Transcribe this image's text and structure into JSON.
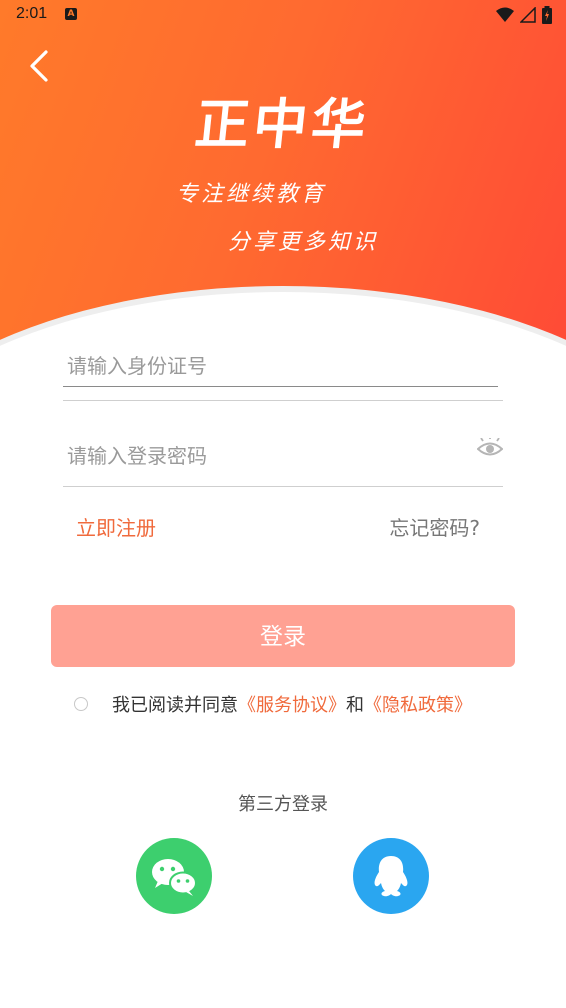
{
  "status_bar": {
    "time": "2:01",
    "a_badge": "A"
  },
  "header": {
    "app_title": "正中华",
    "slogan_line1": "专注继续教育",
    "slogan_line2": "分享更多知识",
    "gradient_start": "#ff7a2a",
    "gradient_end": "#ff4a36"
  },
  "form": {
    "id_placeholder": "请输入身份证号",
    "id_value": "",
    "password_placeholder": "请输入登录密码",
    "password_value": "",
    "register_label": "立即注册",
    "forgot_label": "忘记密码?",
    "login_label": "登录",
    "login_button_color": "#ffa193"
  },
  "agreement": {
    "checked": false,
    "prefix": "我已阅读并同意",
    "service_link": "《服务协议》",
    "conjunction": "和",
    "privacy_link": "《隐私政策》"
  },
  "third_party": {
    "label": "第三方登录",
    "providers": [
      {
        "name": "WeChat",
        "icon": "wechat-icon",
        "color": "#3dcf6e"
      },
      {
        "name": "QQ",
        "icon": "qq-icon",
        "color": "#2aa6f0"
      }
    ]
  },
  "accent_color": "#f06a3c"
}
